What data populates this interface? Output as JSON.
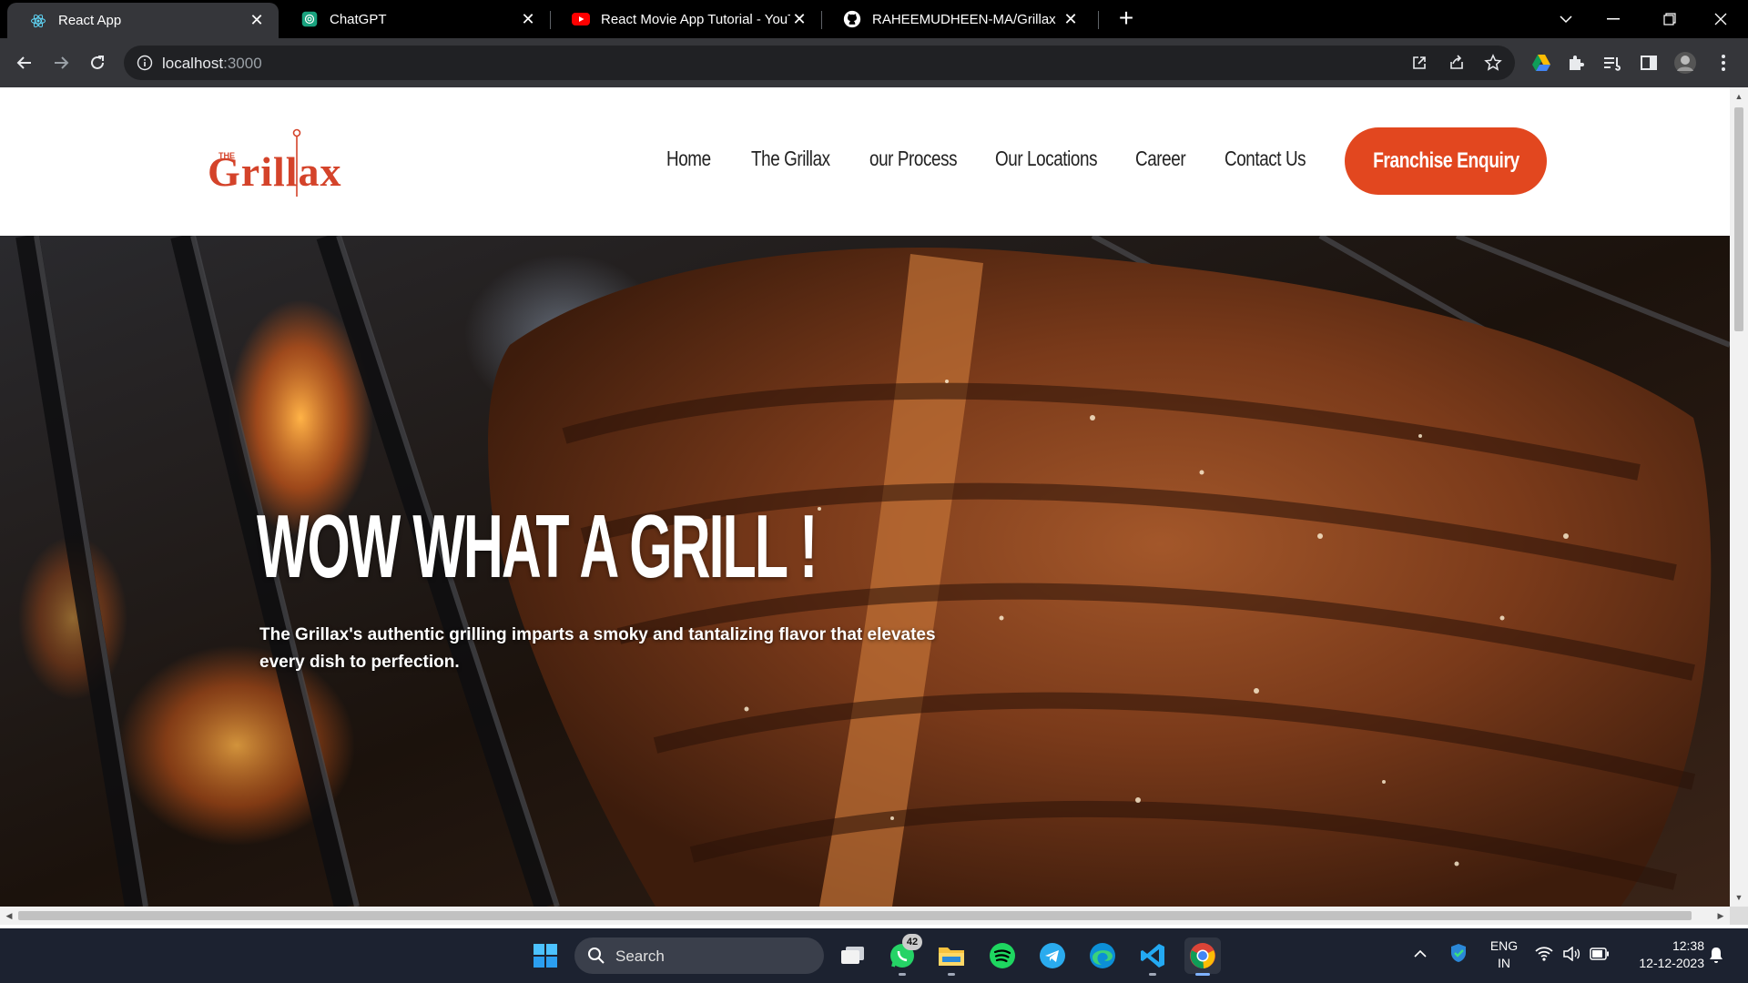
{
  "browser": {
    "tabs": [
      {
        "title": "React App",
        "icon": "react-icon",
        "active": true
      },
      {
        "title": "ChatGPT",
        "icon": "chatgpt-icon",
        "active": false
      },
      {
        "title": "React Movie App Tutorial - YouT",
        "icon": "youtube-icon",
        "active": false
      },
      {
        "title": "RAHEEMUDHEEN-MA/Grillax",
        "icon": "github-icon",
        "active": false
      }
    ],
    "new_tab_label": "+",
    "url_host": "localhost",
    "url_port": ":3000"
  },
  "site": {
    "logo": {
      "small": "THE",
      "main": "Grillax"
    },
    "nav": [
      "Home",
      "The Grillax",
      "our Process",
      "Our Locations",
      "Career",
      "Contact Us"
    ],
    "cta": "Franchise Enquiry",
    "hero": {
      "title": "WOW WHAT A GRILL !",
      "text": "The Grillax's authentic grilling imparts a smoky and tantalizing flavor that elevates every dish to perfection."
    },
    "accent_color": "#e2471f"
  },
  "taskbar": {
    "search_placeholder": "Search",
    "whatsapp_badge": "42",
    "language": "ENG",
    "region": "IN",
    "time": "12:38",
    "date": "12-12-2023"
  }
}
